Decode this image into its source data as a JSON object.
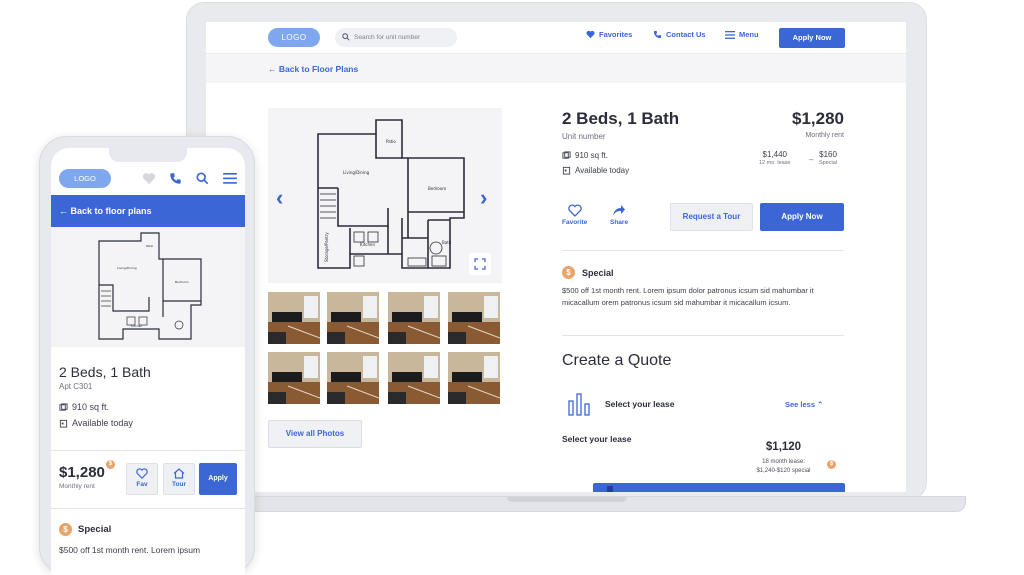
{
  "desktop": {
    "header": {
      "logo": "LOGO",
      "search_placeholder": "Search for unit number",
      "favorites": "Favorites",
      "contact": "Contact Us",
      "menu": "Menu",
      "apply": "Apply Now"
    },
    "back_link": "Back to Floor Plans",
    "view_all": "View all Photos",
    "unit": {
      "title": "2 Beds, 1 Bath",
      "subtitle": "Unit number",
      "price": "$1,280",
      "price_label": "Monthly rent",
      "sqft": "910 sq ft.",
      "availability": "Available today",
      "range_high": "$1,440",
      "range_high_label": "12 mo. lease",
      "range_dash": "–",
      "range_low": "$160",
      "range_low_label": "Special"
    },
    "actions": {
      "favorite": "Favorite",
      "share": "Share",
      "tour": "Request a Tour",
      "apply": "Apply Now"
    },
    "special": {
      "coin": "$",
      "heading": "Special",
      "text": "$500 off 1st month rent. Lorem ipsum dolor patronus icsum sid mahumbar it micacallum orem patronus icsum sid mahumbar it micacallum icsum."
    },
    "quote": {
      "title": "Create a Quote",
      "lease_heading": "Select your lease",
      "see_less": "See less",
      "lease_label": "Select your lease",
      "price": "$1,120",
      "price_sub_1": "18 month lease:",
      "price_sub_2": "$1,240-$120 special"
    }
  },
  "mobile": {
    "logo": "LOGO",
    "back": "Back to floor plans",
    "title": "2 Beds, 1 Bath",
    "apt": "Apt C301",
    "sqft": "910 sq ft.",
    "availability": "Available today",
    "price": "$1,280",
    "price_label": "Monthly rent",
    "fav": "Fav",
    "tour": "Tour",
    "apply": "Apply",
    "special_heading": "Special",
    "special_text": "$500 off 1st month rent. Lorem ipsum"
  },
  "colors": {
    "accent": "#3b66d6",
    "logo_pill": "#7ea7ee",
    "coin": "#e8a46b"
  }
}
